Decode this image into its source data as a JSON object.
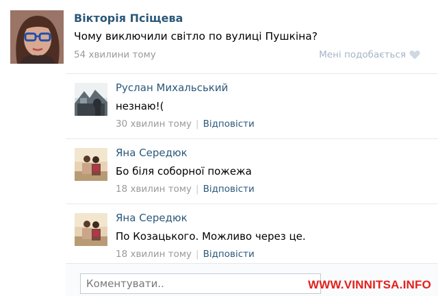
{
  "post": {
    "author": "Вікторія Псіщева",
    "text": "Чому виключили світло по вулиці Пушкіна?",
    "time": "54 хвилини тому",
    "like_label": "Мені подобається",
    "like_icon": "heart-icon"
  },
  "comments": [
    {
      "author": "Руслан Михальський",
      "text": "незнаю!(",
      "time": "30 хвилин тому",
      "separator": "|",
      "reply_label": "Відповісти"
    },
    {
      "author": "Яна Середюк",
      "text": "Бо біля соборної пожежа",
      "time": "18 хвилин тому",
      "separator": "|",
      "reply_label": "Відповісти"
    },
    {
      "author": "Яна Середюк",
      "text": "По Козацького. Можливо через це.",
      "time": "18 хвилин тому",
      "separator": "|",
      "reply_label": "Відповісти"
    }
  ],
  "reply_box": {
    "placeholder": "Коментувати.."
  },
  "watermark": "WWW.VINNITSA.INFO",
  "colors": {
    "link": "#2b587a",
    "meta": "#999999",
    "like": "#a3b4c6",
    "watermark": "#e3201b",
    "divider": "#e4e8ed"
  }
}
